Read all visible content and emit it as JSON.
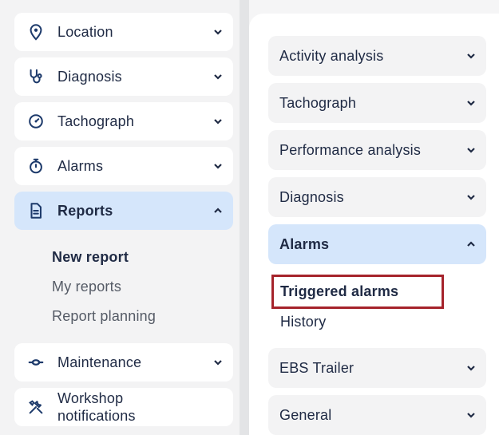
{
  "sidebar": {
    "items": [
      {
        "label": "Location",
        "icon": "location-pin-icon"
      },
      {
        "label": "Diagnosis",
        "icon": "stethoscope-icon"
      },
      {
        "label": "Tachograph",
        "icon": "tachograph-icon"
      },
      {
        "label": "Alarms",
        "icon": "stopwatch-icon"
      },
      {
        "label": "Reports",
        "icon": "report-document-icon",
        "expanded": true
      },
      {
        "label": "Maintenance",
        "icon": "wrench-icon"
      },
      {
        "label": "Workshop\nnotifications",
        "icon": "tools-icon"
      }
    ],
    "reports_subitems": [
      {
        "label": "New report",
        "selected": true
      },
      {
        "label": "My reports"
      },
      {
        "label": "Report planning"
      }
    ]
  },
  "panel": {
    "items": [
      {
        "label": "Activity analysis"
      },
      {
        "label": "Tachograph"
      },
      {
        "label": "Performance analysis"
      },
      {
        "label": "Diagnosis"
      },
      {
        "label": "Alarms",
        "expanded": true
      },
      {
        "label": "EBS Trailer"
      },
      {
        "label": "General"
      }
    ],
    "alarms_subitems": [
      {
        "label": "Triggered alarms",
        "selected": true,
        "highlighted": true
      },
      {
        "label": "History"
      }
    ]
  },
  "colors": {
    "active_bg": "#d5e6fb",
    "text": "#1f2a44",
    "highlight": "#a5232b",
    "icon": "#1d3a6b"
  }
}
